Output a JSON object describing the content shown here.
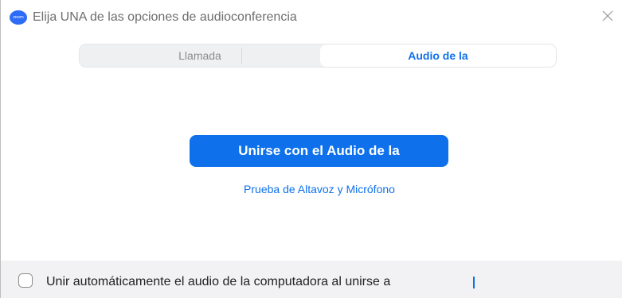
{
  "window": {
    "title": "Elija UNA de las opciones de audioconferencia",
    "app_icon_text": "zoom",
    "close_glyph": "close-icon"
  },
  "tabs": [
    {
      "label": "Llamada",
      "selected": false
    },
    {
      "label": "Audio de la",
      "selected": true
    }
  ],
  "main": {
    "join_button_label": "Unirse con el Audio de la",
    "test_link_label": "Prueba de Altavoz y Micrófono"
  },
  "footer": {
    "checkbox_checked": false,
    "checkbox_label": "Unir automáticamente el audio de la computadora al unirse a"
  },
  "colors": {
    "accent": "#0e71eb",
    "footer_bg": "#f2f2f4",
    "tab_bg": "#eef0f2"
  }
}
